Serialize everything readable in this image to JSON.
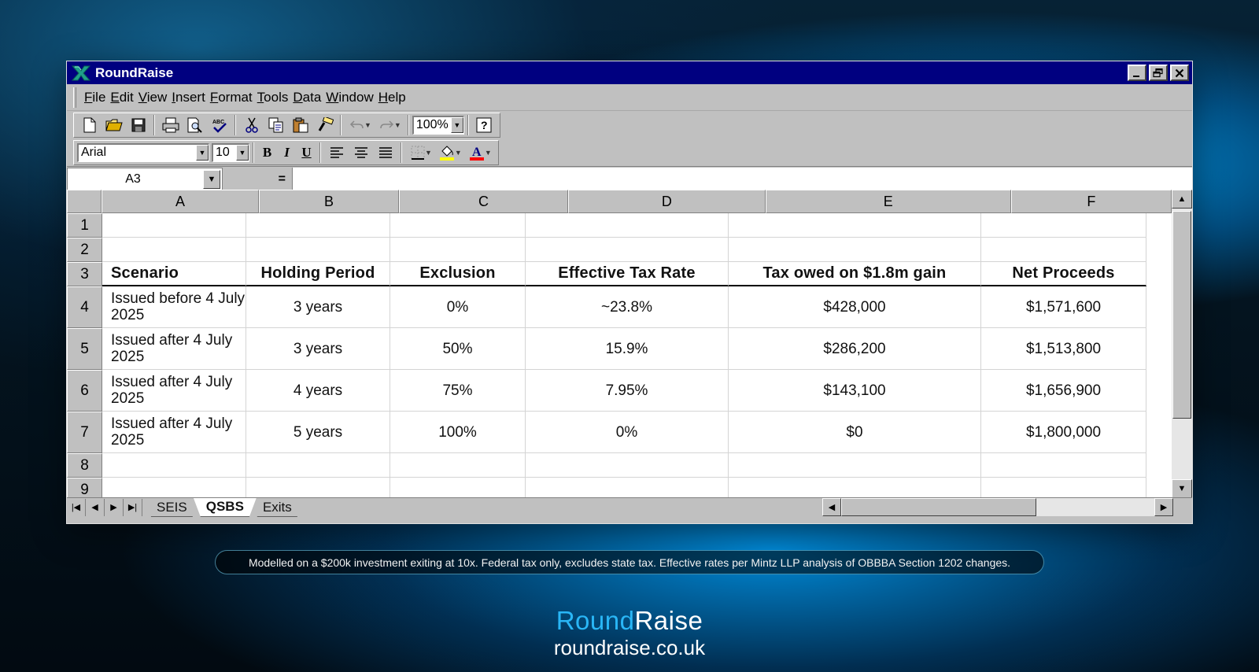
{
  "window": {
    "title": "RoundRaise",
    "controls": {
      "minimize": "_",
      "restore": "❐",
      "close": "✕"
    }
  },
  "menu": [
    "File",
    "Edit",
    "View",
    "Insert",
    "Format",
    "Tools",
    "Data",
    "Window",
    "Help"
  ],
  "toolbar": {
    "zoom": "100%",
    "font": "Arial",
    "size": "10",
    "bold": "B",
    "italic": "I",
    "underline": "U",
    "help": "?"
  },
  "formula_bar": {
    "name_box": "A3",
    "equals": "=",
    "formula": ""
  },
  "columns": [
    "A",
    "B",
    "C",
    "D",
    "E",
    "F"
  ],
  "rows": [
    {
      "num": "1",
      "cells": [
        "",
        "",
        "",
        "",
        "",
        ""
      ]
    },
    {
      "num": "2",
      "cells": [
        "",
        "",
        "",
        "",
        "",
        ""
      ]
    },
    {
      "num": "3",
      "cells": [
        "Scenario",
        "Holding Period",
        "Exclusion",
        "Effective Tax Rate",
        "Tax owed on $1.8m gain",
        "Net Proceeds"
      ]
    },
    {
      "num": "4",
      "cells": [
        "Issued before 4 July 2025",
        "3 years",
        "0%",
        "~23.8%",
        "$428,000",
        "$1,571,600"
      ]
    },
    {
      "num": "5",
      "cells": [
        "Issued after 4 July 2025",
        "3 years",
        "50%",
        "15.9%",
        "$286,200",
        "$1,513,800"
      ]
    },
    {
      "num": "6",
      "cells": [
        "Issued after 4 July 2025",
        "4 years",
        "75%",
        "7.95%",
        "$143,100",
        "$1,656,900"
      ]
    },
    {
      "num": "7",
      "cells": [
        "Issued after 4 July 2025",
        "5 years",
        "100%",
        "0%",
        "$0",
        "$1,800,000"
      ]
    },
    {
      "num": "8",
      "cells": [
        "",
        "",
        "",
        "",
        "",
        ""
      ]
    },
    {
      "num": "9",
      "cells": [
        "",
        "",
        "",
        "",
        "",
        ""
      ]
    }
  ],
  "sheet_tabs": [
    "SEIS",
    "QSBS",
    "Exits"
  ],
  "active_tab": "QSBS",
  "footnote": "Modelled on a $200k investment exiting at 10x. Federal tax only, excludes state tax. Effective rates per Mintz LLP analysis of OBBBA Section 1202 changes.",
  "brand": {
    "part1": "Round",
    "part2": "Raise",
    "url": "roundraise.co.uk"
  },
  "colors": {
    "titlebar": "#000080",
    "brand_accent": "#29b6f6",
    "chrome": "#c0c0c0"
  }
}
